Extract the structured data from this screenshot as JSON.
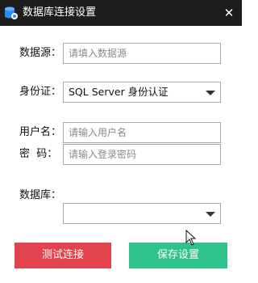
{
  "window": {
    "title": "数据库连接设置",
    "close_glyph": "✕",
    "title_icon": "database-settings-icon"
  },
  "form": {
    "datasource": {
      "label": "数据源：",
      "placeholder": "请填入数据源"
    },
    "auth": {
      "label": "身份证：",
      "selected": "SQL Server 身份认证"
    },
    "username": {
      "label": "用户名：",
      "placeholder": "请输入用户名"
    },
    "password": {
      "label": "密  码：",
      "placeholder": "请输入登录密码"
    },
    "database": {
      "label": "数据库：",
      "selected": ""
    }
  },
  "buttons": {
    "test_label": "测试连接",
    "save_label": "保存设置"
  },
  "colors": {
    "titlebar": "#1d1d1d",
    "test_button": "#e3434e",
    "save_button": "#2fc28a",
    "icon_accent": "#2a8cf0"
  }
}
